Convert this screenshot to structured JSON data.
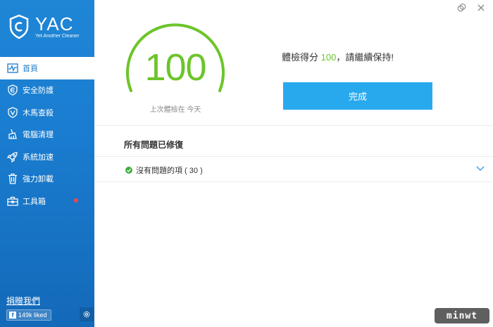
{
  "app": {
    "title": "YAC",
    "subtitle": "Yet Another Cleaner"
  },
  "sidebar": {
    "items": [
      {
        "label": "首頁",
        "icon": "pulse-icon",
        "active": true
      },
      {
        "label": "安全防護",
        "icon": "shield-e-icon",
        "active": false
      },
      {
        "label": "木馬查殺",
        "icon": "shield-v-icon",
        "active": false
      },
      {
        "label": "電腦清理",
        "icon": "broom-icon",
        "active": false
      },
      {
        "label": "系統加速",
        "icon": "rocket-icon",
        "active": false
      },
      {
        "label": "強力卸載",
        "icon": "trash-icon",
        "active": false
      },
      {
        "label": "工具箱",
        "icon": "toolbox-icon",
        "active": false,
        "notification": true
      }
    ],
    "donate_label": "捐贈我們",
    "fb_liked": "149k liked"
  },
  "score": {
    "value": "100",
    "fraction": 1.0,
    "caption": "上次體檢在 今天"
  },
  "result": {
    "prefix": "體檢得分 ",
    "score": "100",
    "suffix": "，請繼續保持!"
  },
  "done_button": {
    "label": "完成"
  },
  "issues": {
    "section_title": "所有問題已修復",
    "row_label": "沒有問題的項 ( 30 )"
  },
  "watermark": "minwt",
  "colors": {
    "sidebar": "#1a7dd0",
    "accent_blue": "#28a9ee",
    "score_green": "#6cc52a",
    "notification_red": "#f04a4a"
  }
}
